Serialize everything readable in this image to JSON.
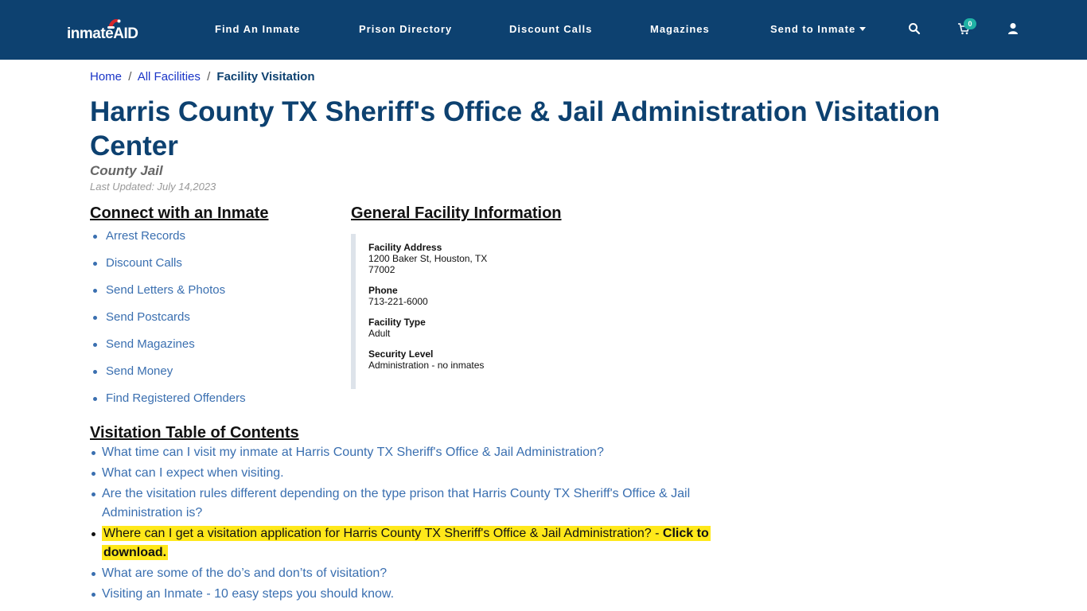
{
  "header": {
    "logo_text_main": "inmate",
    "logo_text_accent": "AID",
    "nav": [
      {
        "label": "Find An Inmate"
      },
      {
        "label": "Prison Directory"
      },
      {
        "label": "Discount Calls"
      },
      {
        "label": "Magazines"
      },
      {
        "label": "Send to Inmate"
      }
    ],
    "cart_count": "0",
    "icons": [
      "search-icon",
      "cart-icon",
      "user-icon"
    ],
    "colors": {
      "nav_bg": "#0d4170",
      "badge": "#20b2a5"
    }
  },
  "breadcrumb": {
    "home": "Home",
    "sep1": "/",
    "all": "All Facilities",
    "sep2": "/",
    "current": "Facility Visitation"
  },
  "page": {
    "title": "Harris County TX Sheriff's Office & Jail Administration Visitation Center",
    "facility_kind": "County Jail",
    "last_updated": "Last Updated: July 14,2023",
    "title_color": "#0d4170"
  },
  "connect": {
    "heading": "Connect with an Inmate",
    "items": [
      "Arrest Records",
      "Discount Calls",
      "Send Letters & Photos",
      "Send Postcards",
      "Send Magazines",
      "Send Money",
      "Find Registered Offenders"
    ]
  },
  "facility_info": {
    "heading": "General Facility Information",
    "address_label": "Facility Address",
    "address_line1": "1200 Baker St, Houston, TX",
    "address_line2": "77002",
    "phone_label": "Phone",
    "phone": "713-221-6000",
    "type_label": "Facility Type",
    "type": "Adult",
    "security_label": "Security Level",
    "security": "Administration - no inmates"
  },
  "toc": {
    "heading": "Visitation Table of Contents",
    "items": [
      "What time can I visit my inmate at Harris County TX Sheriff's Office & Jail Administration?",
      "What can I expect when visiting.",
      "Are the visitation rules different depending on the type prison that Harris County TX Sheriff's Office & Jail Administration is?",
      "What are some of the do’s and don’ts of visitation?",
      "Visiting an Inmate - 10 easy steps you should know."
    ],
    "highlight_text": "Where can I get a visitation application for Harris County TX Sheriff's Office & Jail Administration? - ",
    "highlight_bold": "Click to download.",
    "highlight_color": "#ffe81a"
  }
}
